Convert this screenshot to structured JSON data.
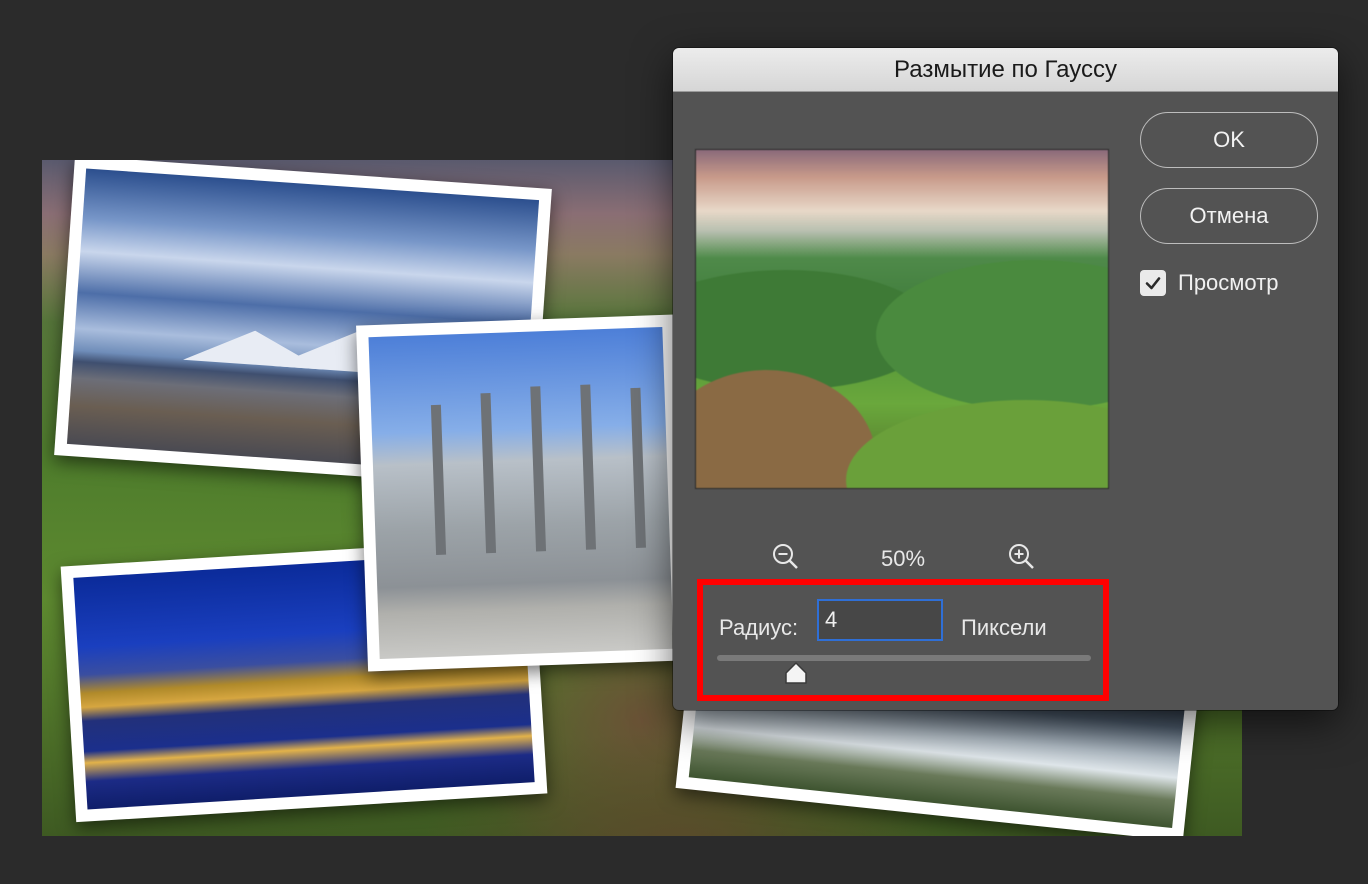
{
  "dialog": {
    "title": "Размытие по Гауссу",
    "ok_label": "OK",
    "cancel_label": "Отмена",
    "preview_label": "Просмотр",
    "preview_checked": true,
    "zoom": {
      "level": "50%",
      "zoom_out_icon": "zoom-out-icon",
      "zoom_in_icon": "zoom-in-icon"
    },
    "radius": {
      "label": "Радиус:",
      "value": "4",
      "units": "Пиксели",
      "slider_fraction": 0.21
    },
    "highlight_color": "#ff0000",
    "focus_color": "#2f6fd6"
  }
}
